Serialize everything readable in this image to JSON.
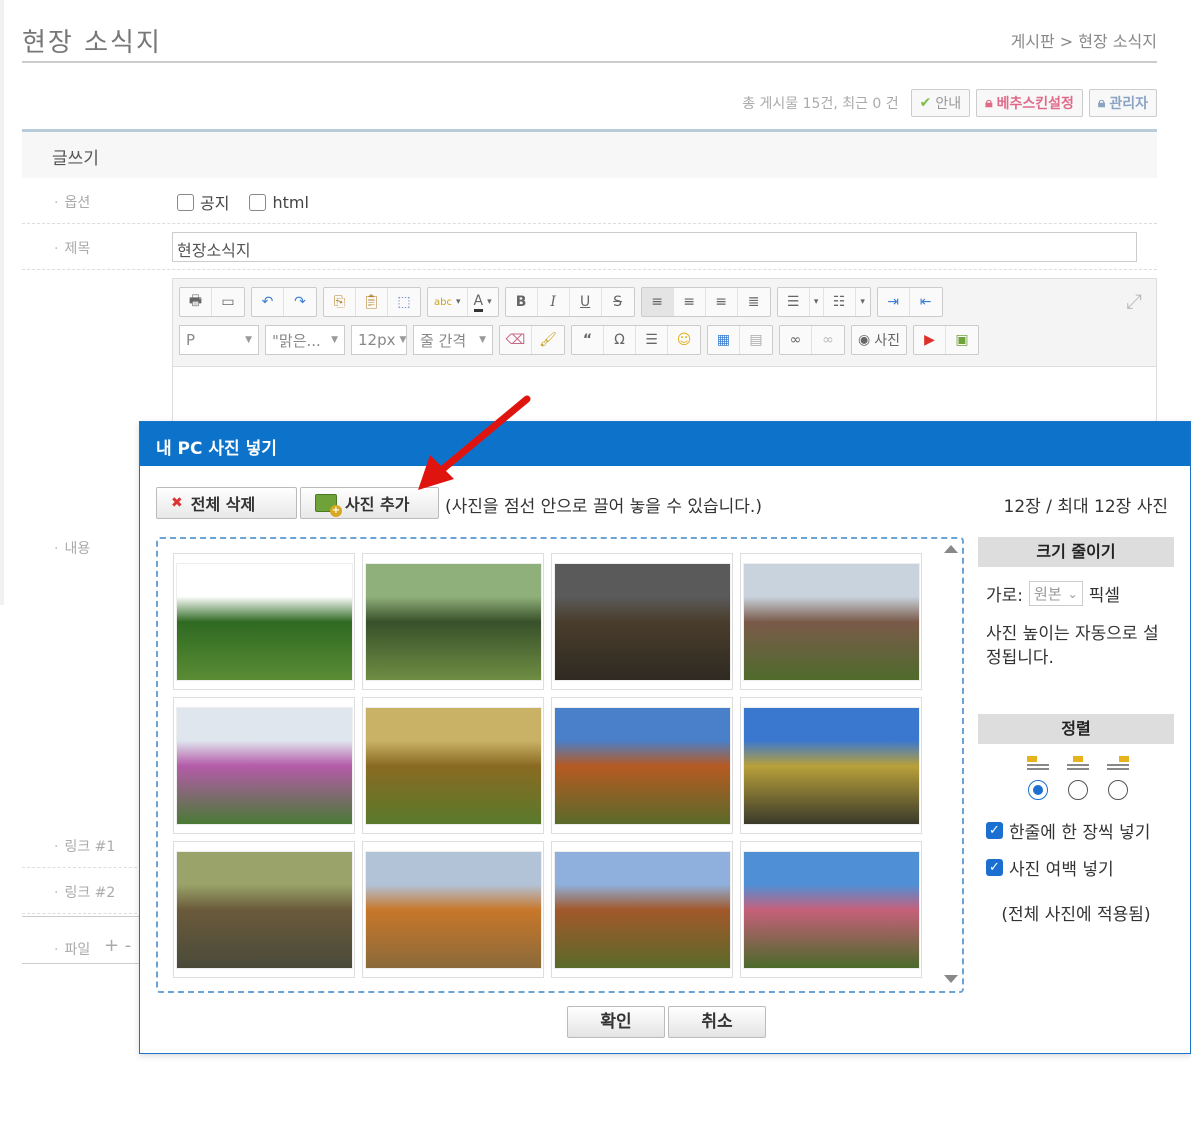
{
  "page": {
    "title": "현장 소식지",
    "breadcrumb": "게시판 > 현장 소식지"
  },
  "board": {
    "stats": "총 게시물 15건, 최근 0 건",
    "guide_label": "안내",
    "skin_label": "베추스킨설정",
    "admin_label": "관리자"
  },
  "form": {
    "heading": "글쓰기",
    "option_label": "옵션",
    "notice_label": "공지",
    "html_label": "html",
    "subject_label": "제목",
    "subject_value": "현장소식지",
    "content_label": "내용",
    "link1_label": "링크 #1",
    "link2_label": "링크 #2",
    "file_label": "파일",
    "file_controls": "+ -"
  },
  "toolbar": {
    "paragraph_select": "P",
    "font_select": "\"맑은...",
    "size_select": "12px",
    "line_height_select": "줄 간격",
    "photo_label": "사진",
    "abc_label": "abc",
    "text_color_label": "A"
  },
  "modal": {
    "title": "내 PC 사진 넣기",
    "delete_all_label": "전체 삭제",
    "add_photo_label": "사진 추가",
    "hint": "(사진을 점선 안으로 끌어 놓을 수 있습니다.)",
    "count": "12장 / 최대 12장 사진",
    "resize_heading": "크기 줄이기",
    "width_label": "가로:",
    "width_value": "원본",
    "pixel_label": "픽셀",
    "height_note": "사진 높이는 자동으로 설정됩니다.",
    "align_heading": "정렬",
    "selected_align": "left",
    "one_per_line_label": "한줄에 한 장씩 넣기",
    "one_per_line_checked": true,
    "margin_label": "사진 여백 넣기",
    "margin_checked": true,
    "applies_note": "(전체 사진에 적용됨)",
    "ok_label": "확인",
    "cancel_label": "취소"
  },
  "photos": [
    {
      "sky": "#ffffff",
      "mid": "#2f6a22",
      "ground": "#5a8c34"
    },
    {
      "sky": "#8fb07a",
      "mid": "#38502a",
      "ground": "#6f8d43"
    },
    {
      "sky": "#5a5a5a",
      "mid": "#4a3d2c",
      "ground": "#2f2a22"
    },
    {
      "sky": "#c9d3dd",
      "mid": "#7a5a4a",
      "ground": "#4f6b2c"
    },
    {
      "sky": "#dfe6ee",
      "mid": "#b45ba8",
      "ground": "#4a7a36"
    },
    {
      "sky": "#c9b266",
      "mid": "#8a6a22",
      "ground": "#5a7a2c"
    },
    {
      "sky": "#4a7fc9",
      "mid": "#b65a22",
      "ground": "#5a6a2a"
    },
    {
      "sky": "#3a78d0",
      "mid": "#b8a03a",
      "ground": "#3a3a2a"
    },
    {
      "sky": "#9aa36a",
      "mid": "#6a5a3a",
      "ground": "#4a4a3a"
    },
    {
      "sky": "#b2c3d8",
      "mid": "#c8772a",
      "ground": "#8a6a3a"
    },
    {
      "sky": "#8fb0dc",
      "mid": "#a2582a",
      "ground": "#5a6a2a"
    },
    {
      "sky": "#4f8fd6",
      "mid": "#c6607a",
      "ground": "#4a6a2a"
    }
  ]
}
